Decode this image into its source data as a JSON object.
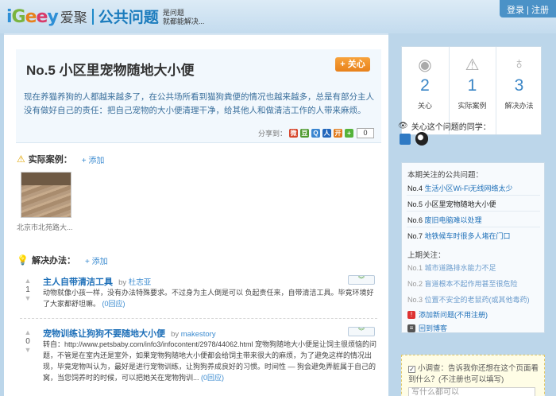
{
  "header": {
    "logo_letters": [
      "i",
      "G",
      "e",
      "e",
      "y"
    ],
    "logo_colors": [
      "#2e8fd6",
      "#7ab43f",
      "#e8811b",
      "#d93a6a",
      "#2e8fd6"
    ],
    "logo_cn": "爱聚",
    "section": "公共问题",
    "tagline_1": "是问题",
    "tagline_2": "就都能解决...",
    "login": "登录",
    "sep": "|",
    "register": "注册"
  },
  "question": {
    "title": "No.5 小区里宠物随地大小便",
    "care_button": "+ 关心",
    "description": "现在养猫养狗的人都越来越多了，在公共场所看到猫狗粪便的情况也越来越多，总是有部分主人没有做好自己的责任：把自己宠物的大小便清理干净，给其他人和做清洁工作的人带来麻烦。",
    "share_label": "分享到：",
    "share_count": "0"
  },
  "cases": {
    "heading": "实际案例：",
    "add": "+ 添加",
    "caption": "北京市北苑路大..."
  },
  "solutions": {
    "heading": "解决办法：",
    "add": "+ 添加",
    "items": [
      {
        "votes": "1",
        "title": "主人自带清洁工具",
        "by": "by",
        "author": "杜志亚",
        "body": "动物就像小孩一样，没有办法特殊要求。不过身为主人倒是可以 负起责任来，自带清洁工具。毕竟环境好了大家都舒坦嘛。",
        "replies": "(0回应)"
      },
      {
        "votes": "0",
        "title": "宠物训练让狗狗不要随地大小便",
        "by": "by",
        "author": "makestory",
        "body": "转自：http://www.petsbaby.com/info3/infocontent/2978/44062.html 宠物狗随地大小便是让饲主很烦恼的问题，不管是在室内还是室外，如果宠物狗随地大小便都会给饲主带来很大的麻烦，为了避免这样的情况出现，毕竟宠物叫认为，最好是进行宠物训练，让狗狗养成良好的习惯。时间性 — 狗会避免弄脏属于自己的窝，当您饲养时的时候，可以把她关在宠物狗训...",
        "replies": "(0回应)"
      }
    ]
  },
  "sidebar": {
    "stats": [
      {
        "icon": "eye-icon",
        "value": "2",
        "label": "关心"
      },
      {
        "icon": "warning-icon",
        "value": "1",
        "label": "实际案例"
      },
      {
        "icon": "bulb-icon",
        "value": "3",
        "label": "解决办法"
      }
    ],
    "watchers_heading": "关心这个问题的同学：",
    "current_heading": "本期关注的公共问题：",
    "current": [
      {
        "no": "No.4",
        "title": "生活小区Wi-Fi无线网络太少"
      },
      {
        "no": "No.5",
        "title": "小区里宠物随地大小便"
      },
      {
        "no": "No.6",
        "title": "废旧电脑难以处理"
      },
      {
        "no": "No.7",
        "title": "地铁候车时很多人堵在门口"
      }
    ],
    "past_heading": "上期关注：",
    "past": [
      {
        "no": "No.1",
        "title": "城市道路排水能力不足"
      },
      {
        "no": "No.2",
        "title": "盲道根本不起作用甚至很危险"
      },
      {
        "no": "No.3",
        "title": "位置不安全的老鼠药(或其他毒药)"
      }
    ],
    "add_issue": "添加新问题(不用注册)",
    "back_blog": "回到博客",
    "survey_q": "小调查：告诉我你还想在这个页面看到什么？(不注册也可以填写)",
    "survey_placeholder": "写什么都可以"
  },
  "colors": {
    "accent": "#1d6fb8",
    "orange": "#e8811b",
    "header_bg": "#c3dbee"
  }
}
